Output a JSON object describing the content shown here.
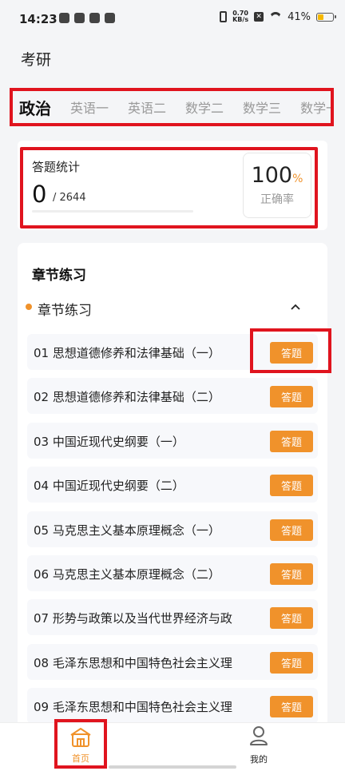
{
  "status_bar": {
    "time": "14:23",
    "net_speed_value": "0.70",
    "net_speed_unit": "KB/s",
    "battery": "41%",
    "battery_level": 0.41
  },
  "header": {
    "title": "考研"
  },
  "tabs": [
    {
      "label": "政治",
      "active": true
    },
    {
      "label": "英语一"
    },
    {
      "label": "英语二"
    },
    {
      "label": "数学二"
    },
    {
      "label": "数学三"
    },
    {
      "label": "数学一"
    }
  ],
  "stats": {
    "label": "答题统计",
    "answered": "0",
    "total": "/ 2644",
    "progress": 0,
    "rate_value": "100",
    "rate_unit": "%",
    "rate_label": "正确率"
  },
  "chapter": {
    "section_title": "章节练习",
    "group_title": "章节练习",
    "button_label": "答题",
    "items": [
      "01  思想道德修养和法律基础（一）",
      "02  思想道德修养和法律基础（二）",
      "03  中国近现代史纲要（一）",
      "04  中国近现代史纲要（二）",
      "05  马克思主义基本原理概念（一）",
      "06  马克思主义基本原理概念（二）",
      "07  形势与政策以及当代世界经济与政",
      "08  毛泽东思想和中国特色社会主义理",
      "09  毛泽东思想和中国特色社会主义理"
    ]
  },
  "nav": {
    "home": "首页",
    "mine": "我的"
  },
  "colors": {
    "accent": "#f0922b",
    "highlight": "#e0141e",
    "background": "#f4f5f7"
  }
}
